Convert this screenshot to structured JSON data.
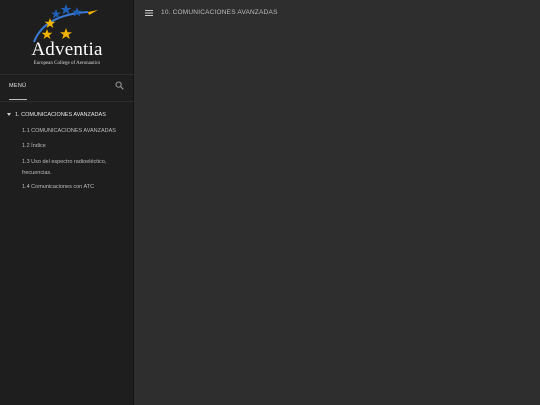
{
  "logo": {
    "name": "Adventia",
    "subtitle": "European College of Aeronautics"
  },
  "sidebar": {
    "menu_label": "MENÚ",
    "tree": [
      {
        "label": "1.  COMUNICACIONES AVANZADAS",
        "level": 0,
        "expanded": true
      },
      {
        "label": "1.1  COMUNICACIONES AVANZADAS",
        "level": 1
      },
      {
        "label": "1.2  Índice",
        "level": 1
      },
      {
        "label": "1.3  Uso del espectro radioeléctico, frecuencias.",
        "level": 1
      },
      {
        "label": "1.4  Comunicaciones con ATC",
        "level": 1
      }
    ]
  },
  "topbar": {
    "title": "10. COMUNICACIONES AVANZADAS"
  },
  "colors": {
    "sidebar_bg": "#1e1e1e",
    "content_bg": "#2e2e2e",
    "star_gold": "#f2b400",
    "star_blue": "#1f5fb5"
  },
  "icons": {
    "menu": "hamburger-icon",
    "search": "search-icon",
    "expand": "caret-down-icon"
  }
}
